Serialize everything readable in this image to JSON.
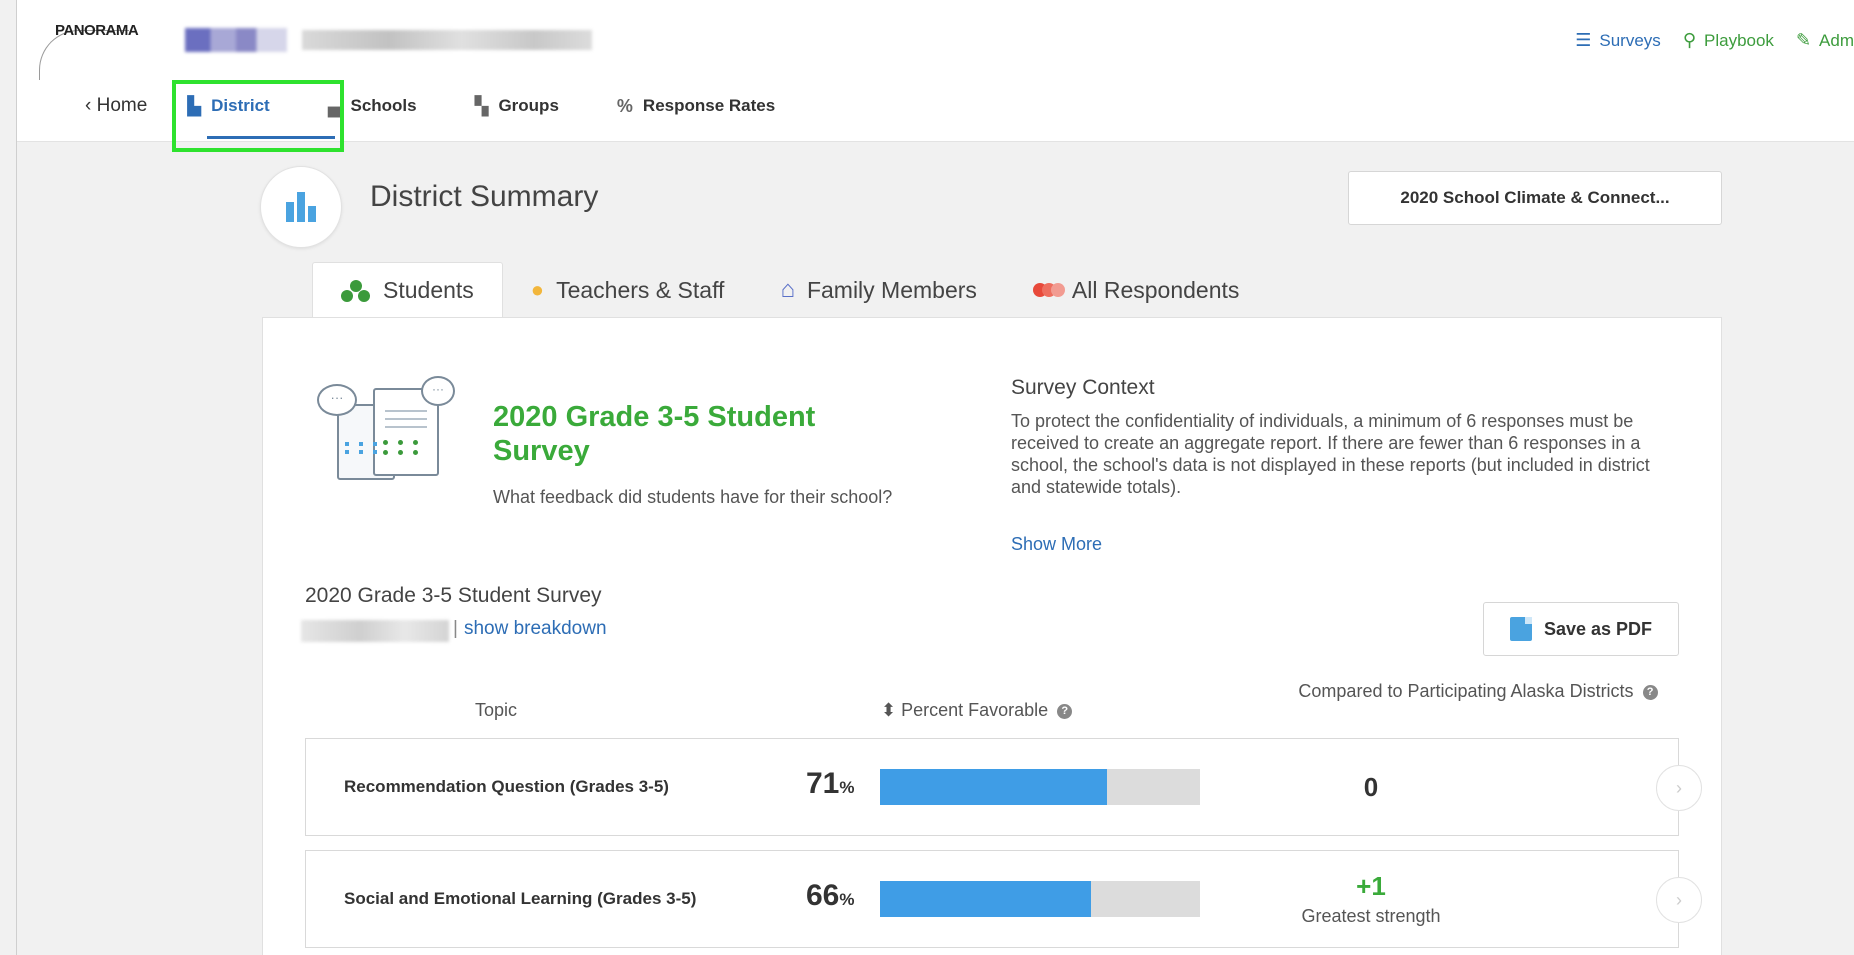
{
  "header": {
    "logo_text": "PANORAMA",
    "links": [
      {
        "label": "Surveys",
        "icon": "list-icon"
      },
      {
        "label": "Playbook",
        "icon": "playbook-icon"
      },
      {
        "label": "Adm",
        "icon": "admin-icon"
      }
    ]
  },
  "nav": {
    "home": "‹ Home",
    "district": "District",
    "schools": "Schools",
    "groups": "Groups",
    "response_rates": "Response Rates"
  },
  "summary": {
    "title": "District Summary",
    "survey_select": "2020 School Climate & Connect..."
  },
  "tabs": [
    {
      "label": "Students",
      "active": true
    },
    {
      "label": "Teachers & Staff",
      "active": false
    },
    {
      "label": "Family Members",
      "active": false
    },
    {
      "label": "All Respondents",
      "active": false
    }
  ],
  "survey": {
    "title": "2020 Grade 3-5 Student Survey",
    "description": "What feedback did students have for their school?",
    "context_title": "Survey Context",
    "context_body": "To protect the confidentiality of individuals, a minimum of 6 responses must be received to create an aggregate report. If there are fewer than 6 responses in a school, the school's data is not displayed in these reports (but included in district and statewide totals).",
    "show_more": "Show More",
    "report_title": "2020 Grade 3-5 Student Survey",
    "breakdown_link": "show breakdown",
    "pdf_button": "Save as PDF"
  },
  "table": {
    "col_topic": "Topic",
    "col_pct": "⬍ Percent Favorable",
    "col_compare": "Compared to Participating Alaska Districts",
    "rows": [
      {
        "topic": "Recommendation Question (Grades 3-5)",
        "pct": "71",
        "pct_value": 0.71,
        "compare": "0",
        "note": ""
      },
      {
        "topic": "Social and Emotional Learning (Grades 3-5)",
        "pct": "66",
        "pct_value": 0.66,
        "compare": "+1",
        "note": "Greatest strength"
      }
    ],
    "pct_suffix": "%"
  },
  "colors": {
    "accent_blue": "#2d6db5",
    "bar_fill": "#3f9de6",
    "bar_track": "#dcdcdc",
    "green": "#3aaa3a",
    "highlight": "#2ee22e"
  }
}
